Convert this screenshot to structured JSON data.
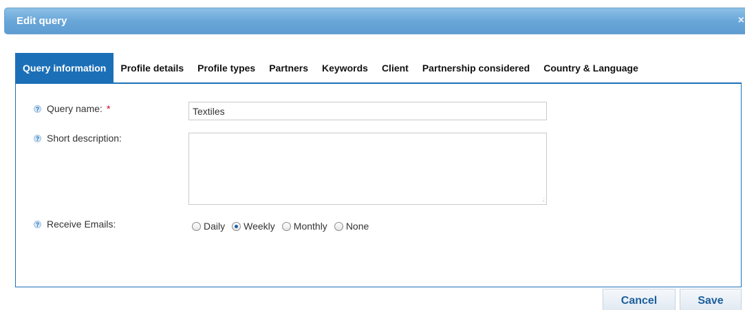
{
  "dialog": {
    "title": "Edit query",
    "close_icon": "×"
  },
  "tabs": [
    {
      "label": "Query information",
      "active": true
    },
    {
      "label": "Profile details"
    },
    {
      "label": "Profile types"
    },
    {
      "label": "Partners"
    },
    {
      "label": "Keywords"
    },
    {
      "label": "Client"
    },
    {
      "label": "Partnership considered"
    },
    {
      "label": "Country & Language"
    }
  ],
  "form": {
    "help_icon": "?",
    "required_mark": "*",
    "query_name": {
      "label": "Query name:",
      "value": "Textiles"
    },
    "short_description": {
      "label": "Short description:",
      "value": ""
    },
    "receive_emails": {
      "label": "Receive Emails:",
      "options": [
        "Daily",
        "Weekly",
        "Monthly",
        "None"
      ],
      "selected": "Weekly"
    }
  },
  "buttons": {
    "cancel": "Cancel",
    "save": "Save"
  },
  "colors": {
    "accent": "#1b6fb7",
    "title_bar": "#6aa7d9",
    "required": "#d0021b"
  }
}
